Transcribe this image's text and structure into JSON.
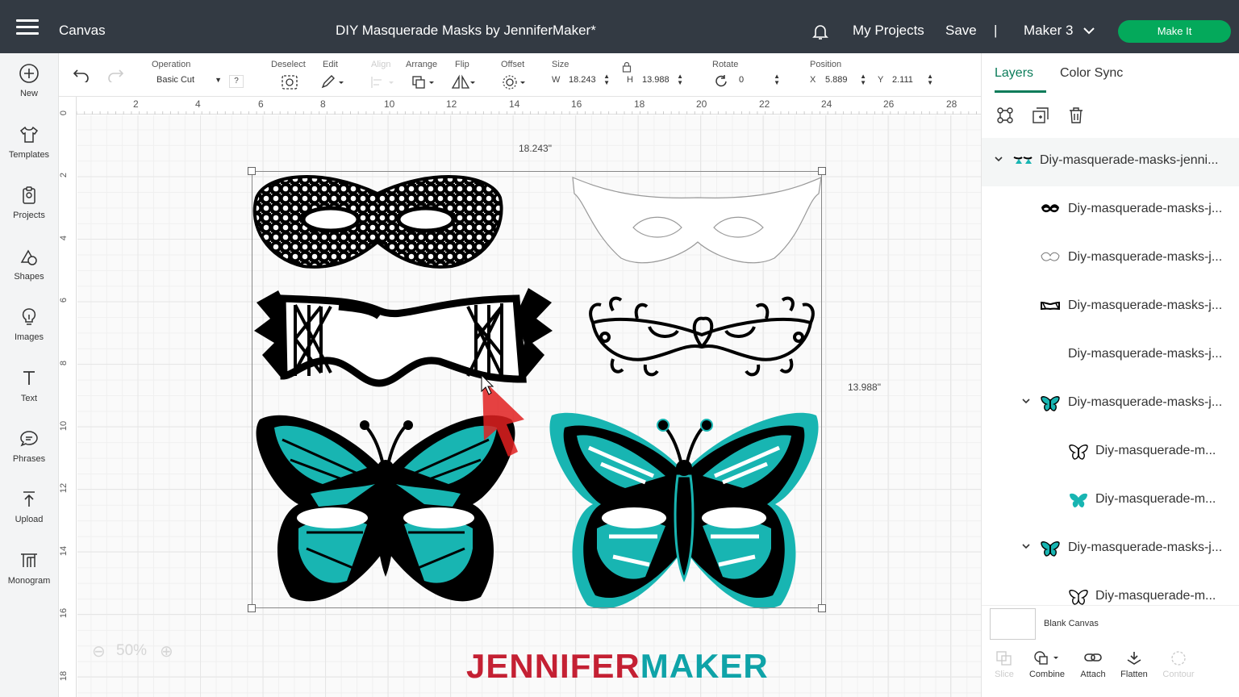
{
  "topbar": {
    "app_name": "Canvas",
    "project_title": "DIY Masquerade Masks by JenniferMaker*",
    "my_projects": "My Projects",
    "save": "Save",
    "separator": "|",
    "machine": "Maker 3",
    "make_it": "Make It",
    "make_it_color": "#04a95b"
  },
  "sidebar": {
    "items": [
      {
        "label": "New",
        "icon": "plus-circle-icon"
      },
      {
        "label": "Templates",
        "icon": "shirt-icon"
      },
      {
        "label": "Projects",
        "icon": "projects-icon"
      },
      {
        "label": "Shapes",
        "icon": "shapes-icon"
      },
      {
        "label": "Images",
        "icon": "lightbulb-icon"
      },
      {
        "label": "Text",
        "icon": "text-icon"
      },
      {
        "label": "Phrases",
        "icon": "speech-bubble-icon"
      },
      {
        "label": "Upload",
        "icon": "upload-icon"
      },
      {
        "label": "Monogram",
        "icon": "monogram-icon"
      }
    ]
  },
  "toolbar": {
    "operation_label": "Operation",
    "operation_value": "Basic Cut",
    "help": "?",
    "deselect_label": "Deselect",
    "edit_label": "Edit",
    "align_label": "Align",
    "arrange_label": "Arrange",
    "flip_label": "Flip",
    "offset_label": "Offset",
    "size_label": "Size",
    "w_label": "W",
    "w_value": "18.243",
    "h_label": "H",
    "h_value": "13.988",
    "rotate_label": "Rotate",
    "rotate_value": "0",
    "position_label": "Position",
    "x_label": "X",
    "x_value": "5.889",
    "y_label": "Y",
    "y_value": "2.111"
  },
  "rulers": {
    "top": [
      "2",
      "4",
      "6",
      "8",
      "10",
      "12",
      "14",
      "16",
      "18",
      "20",
      "22",
      "24",
      "26",
      "28"
    ],
    "left": [
      "0",
      "2",
      "4",
      "6",
      "8",
      "10",
      "12",
      "14",
      "16",
      "18"
    ]
  },
  "canvas": {
    "width_dim": "18.243\"",
    "height_dim": "13.988\"",
    "zoom": "50%",
    "brand_part1": "JENNIFER",
    "brand_part2": "MAKER"
  },
  "panel": {
    "tab_layers": "Layers",
    "tab_color_sync": "Color Sync",
    "layers": [
      {
        "label": "Diy-masquerade-masks-jenni...",
        "icon": "group-thumb-icon",
        "chevron": true
      },
      {
        "label": "Diy-masquerade-masks-j...",
        "icon": "black-mask-thumb-icon",
        "chevron": false
      },
      {
        "label": "Diy-masquerade-masks-j...",
        "icon": "outline-mask-thumb-icon",
        "chevron": false
      },
      {
        "label": "Diy-masquerade-masks-j...",
        "icon": "striped-mask-thumb-icon",
        "chevron": false
      },
      {
        "label": "Diy-masquerade-masks-j...",
        "icon": "filigree-mask-thumb-icon",
        "chevron": false
      },
      {
        "label": "Diy-masquerade-masks-j...",
        "icon": "butterfly-thumb-icon",
        "chevron": true
      },
      {
        "label": "Diy-masquerade-m...",
        "icon": "butterfly-outline-thumb-icon",
        "chevron": false
      },
      {
        "label": "Diy-masquerade-m...",
        "icon": "butterfly-teal-thumb-icon",
        "chevron": false
      },
      {
        "label": "Diy-masquerade-masks-j...",
        "icon": "butterfly-thumb-icon",
        "chevron": true
      },
      {
        "label": "Diy-masquerade-m...",
        "icon": "butterfly-outline-thumb-icon",
        "chevron": false
      }
    ],
    "blank_canvas": "Blank Canvas",
    "bottom_tools": [
      {
        "label": "Slice",
        "icon": "slice-icon",
        "enabled": false
      },
      {
        "label": "Combine",
        "icon": "combine-icon",
        "enabled": true
      },
      {
        "label": "Attach",
        "icon": "attach-icon",
        "enabled": true
      },
      {
        "label": "Flatten",
        "icon": "flatten-icon",
        "enabled": true
      },
      {
        "label": "Contour",
        "icon": "contour-icon",
        "enabled": false
      }
    ]
  },
  "colors": {
    "teal": "#18b5b2",
    "selected_tab": "#0b7c5a",
    "topbar": "#333a43"
  }
}
